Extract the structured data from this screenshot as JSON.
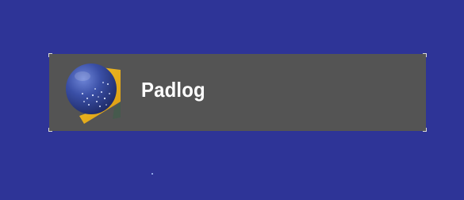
{
  "desktop": {
    "background_color": "#2e3497"
  },
  "app_tile": {
    "label": "Padlog",
    "icon": "padlog-globe-folder-icon",
    "tile_color": "#545454",
    "label_color": "#ffffff",
    "icon_colors": {
      "globe": "#2e3f8f",
      "folder": "#e8b21a"
    }
  }
}
